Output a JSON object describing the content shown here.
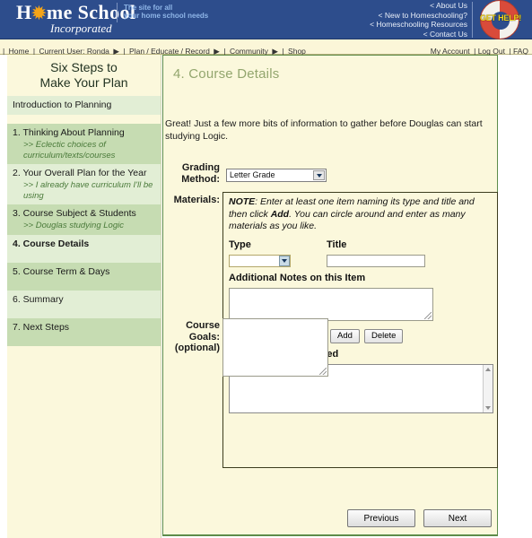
{
  "header": {
    "logo_main_pre": "H",
    "logo_star": "✹",
    "logo_main_post": "me School",
    "logo_sub": "Incorporated",
    "tagline_line1": "The site for all",
    "tagline_line2": "your home school needs",
    "links": [
      "< About Us",
      "< New to Homeschooling?",
      "< Homeschooling Resources",
      "< Contact Us"
    ],
    "help_badge": "GET HELP!",
    "brand_color": "#2d4d8c",
    "accent_color": "#f5a417"
  },
  "nav": {
    "left_items": [
      {
        "label": "Home",
        "arrow": false
      },
      {
        "label": "Current User: Ronda",
        "arrow": true
      },
      {
        "label": "Plan / Educate / Record",
        "arrow": true
      },
      {
        "label": "Community",
        "arrow": true
      },
      {
        "label": "Shop",
        "arrow": false
      }
    ],
    "right_items": [
      "My Account",
      "Log Out",
      "FAQ"
    ],
    "separator": "|",
    "arrow": "▶"
  },
  "sidebar": {
    "title_line1": "Six Steps to",
    "title_line2": "Make Your Plan",
    "items": [
      {
        "label": "Introduction to Planning",
        "sub": "",
        "style": "light",
        "active": false
      },
      {
        "label": "1. Thinking About Planning",
        "sub": ">> Eclectic choices of curriculum/texts/courses",
        "style": "dark",
        "active": false
      },
      {
        "label": "2. Your Overall Plan for the Year",
        "sub": ">> I already have curriculum I'll be using",
        "style": "light",
        "active": false
      },
      {
        "label": "3. Course Subject & Students",
        "sub": ">> Douglas studying Logic",
        "style": "dark",
        "active": false
      },
      {
        "label": "4. Course Details",
        "sub": "",
        "style": "light",
        "active": true
      },
      {
        "label": "5. Course Term & Days",
        "sub": "",
        "style": "dark",
        "active": false
      },
      {
        "label": "6. Summary",
        "sub": "",
        "style": "light",
        "active": false
      },
      {
        "label": "7. Next Steps",
        "sub": "",
        "style": "dark",
        "active": false
      }
    ]
  },
  "main": {
    "page_title": "4. Course Details",
    "intro": "Great! Just a few more bits of information to gather before Douglas can start studying Logic.",
    "grading": {
      "label_line1": "Grading",
      "label_line2": "Method:",
      "value": "Letter Grade"
    },
    "materials": {
      "label": "Materials:",
      "note_lead": "NOTE",
      "note_part1": ": Enter at least one item naming its type and title and then click ",
      "note_bold": "Add",
      "note_part2": ". You can circle around and enter as many materials as you like.",
      "type_header": "Type",
      "type_value": "",
      "title_header": "Title",
      "title_value": "",
      "notes_header": "Additional Notes on this Item",
      "notes_value": "",
      "add_button": "Add",
      "delete_button": "Delete",
      "added_header": "Materials You've Added",
      "added_value": ""
    },
    "goals": {
      "label_line1": "Course",
      "label_line2": "Goals:",
      "label_line3": "(optional)",
      "value": ""
    },
    "previous_button": "Previous",
    "next_button": "Next"
  },
  "colors": {
    "page_cream": "#fbf8dc",
    "panel_border_green": "#5d8c4a",
    "sidebar_light": "#e2eed5",
    "sidebar_dark": "#c6dcb2",
    "title_green": "#93a66e",
    "sub_green": "#4a7a3a"
  }
}
